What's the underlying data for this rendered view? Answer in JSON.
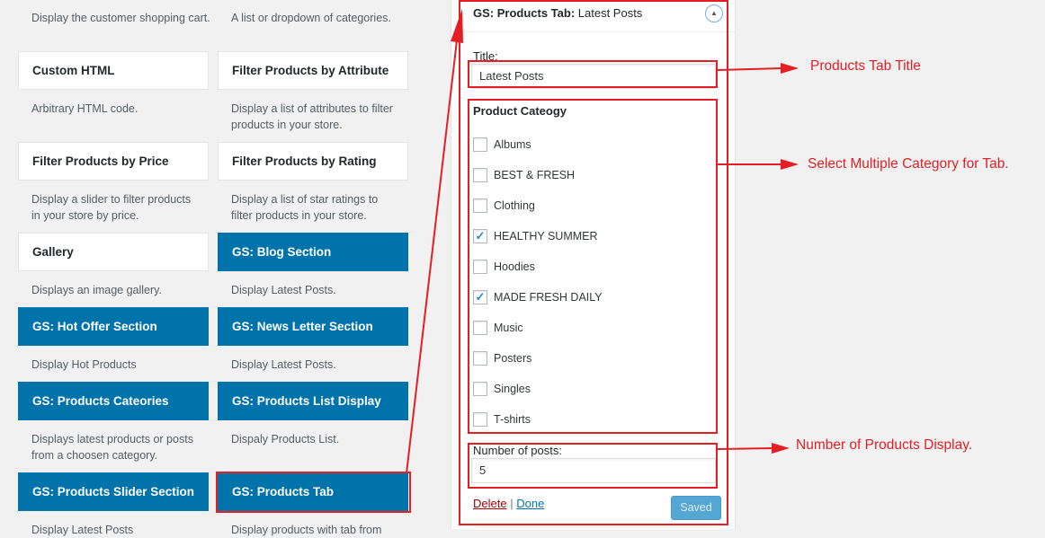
{
  "widgets": [
    {
      "name": "",
      "desc": "Display the customer shopping cart."
    },
    {
      "name": "",
      "desc": "A list or dropdown of categories."
    },
    {
      "name": "Custom HTML",
      "desc": "Arbitrary HTML code."
    },
    {
      "name": "Filter Products by Attribute",
      "desc": "Display a list of attributes to filter products in your store."
    },
    {
      "name": "Filter Products by Price",
      "desc": "Display a slider to filter products in your store by price."
    },
    {
      "name": "Filter Products by Rating",
      "desc": "Display a list of star ratings to filter products in your store."
    },
    {
      "name": "Gallery",
      "desc": "Displays an image gallery."
    },
    {
      "name": "GS: Blog Section",
      "desc": "Display Latest Posts."
    },
    {
      "name": "GS: Hot Offer Section",
      "desc": "Display Hot Products"
    },
    {
      "name": "GS: News Letter Section",
      "desc": "Display Latest Posts."
    },
    {
      "name": "GS: Products Cateories",
      "desc": "Displays latest products or posts from a choosen category."
    },
    {
      "name": "GS: Products List Display",
      "desc": "Dispaly Products List."
    },
    {
      "name": "GS: Products Slider Section",
      "desc": "Display Latest Posts"
    },
    {
      "name": "GS: Products Tab",
      "desc": "Display products with tab from"
    }
  ],
  "panel": {
    "title_strong": "GS: Products Tab:",
    "title_rest": " Latest Posts",
    "toggle_icon": "triangle-up-icon",
    "title_label": "Title:",
    "title_value": "Latest Posts",
    "category_heading": "Product Cateogy",
    "categories": [
      {
        "label": "Albums",
        "checked": false
      },
      {
        "label": "BEST & FRESH",
        "checked": false
      },
      {
        "label": "Clothing",
        "checked": false
      },
      {
        "label": "HEALTHY SUMMER",
        "checked": true
      },
      {
        "label": "Hoodies",
        "checked": false
      },
      {
        "label": "MADE FRESH DAILY",
        "checked": true
      },
      {
        "label": "Music",
        "checked": false
      },
      {
        "label": "Posters",
        "checked": false
      },
      {
        "label": "Singles",
        "checked": false
      },
      {
        "label": "T-shirts",
        "checked": false
      }
    ],
    "posts_label": "Number of posts:",
    "posts_value": "5",
    "delete_label": "Delete",
    "separator": "|",
    "done_label": "Done",
    "saved_label": "Saved"
  },
  "annotations": {
    "title": "Products Tab Title",
    "category": "Select Multiple Category for Tab.",
    "posts": "Number of Products Display."
  },
  "colors": {
    "accent": "#0073aa",
    "annotation": "#e31e24",
    "saved": "#54a7d2"
  }
}
